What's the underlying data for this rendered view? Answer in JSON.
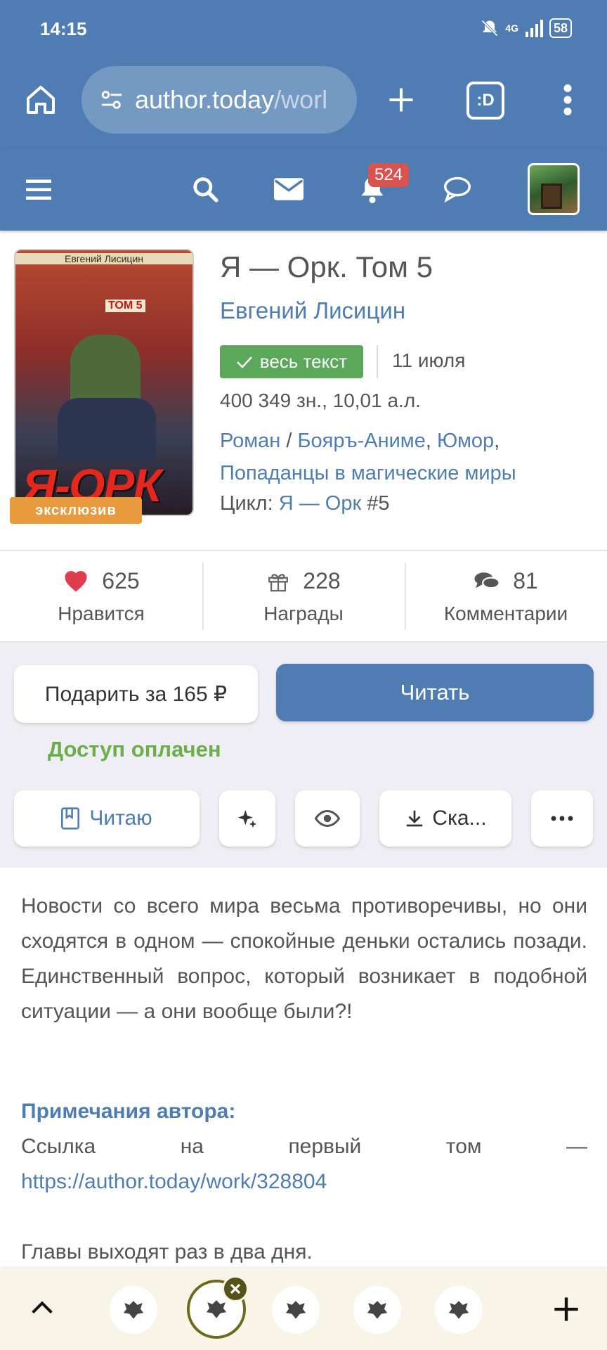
{
  "status_bar": {
    "time": "14:15",
    "network": "4G",
    "battery": "58"
  },
  "browser": {
    "url_host": "author.today",
    "url_path": "/worl"
  },
  "nav": {
    "notifications_count": "524"
  },
  "book": {
    "cover": {
      "author": "Евгений Лисицин",
      "tom": "ТОМ 5",
      "title": "Я-ОРК"
    },
    "exclusive_label": "эксклюзив",
    "title": "Я — Орк. Том 5",
    "author": "Евгений Лисицин",
    "status_label": "весь текст",
    "date": "11 июля",
    "size": "400 349 зн., 10,01 а.л.",
    "genre_1": "Роман",
    "genre_sep_1": " / ",
    "genre_2": "Бояръ-Аниме",
    "genre_sep_2": ", ",
    "genre_3": "Юмор",
    "genre_sep_3": ",",
    "genre_4": "Попаданцы в магические миры",
    "cycle_label": "Цикл: ",
    "cycle_name": "Я — Орк",
    "cycle_num": " #5"
  },
  "stats": {
    "likes": {
      "value": "625",
      "label": "Нравится"
    },
    "awards": {
      "value": "228",
      "label": "Награды"
    },
    "comments": {
      "value": "81",
      "label": "Комментарии"
    }
  },
  "actions": {
    "gift_label": "Подарить за 165 ₽",
    "read_label": "Читать",
    "paid_label": "Доступ оплачен",
    "reading_label": "Читаю",
    "download_label": "Ска..."
  },
  "description": {
    "text": "Новости со всего мира весьма противоречивы, но они сходятся в одном — спокойные деньки оста­лись позади. Единственный вопрос, который воз­никает в подобной ситуации — а они вообще были?!",
    "notes_heading": "Примечания автора:",
    "link_words": [
      "Ссылка",
      "на",
      "первый",
      "том",
      "—"
    ],
    "link_url": "https://author.today/work/328804",
    "chapters": "Главы выходят раз в два дня."
  },
  "colors": {
    "brand": "#4f7db3",
    "success": "#5ba85a",
    "paid": "#6bae4a",
    "badge": "#d9534f",
    "exclusive": "#e89b3c"
  }
}
